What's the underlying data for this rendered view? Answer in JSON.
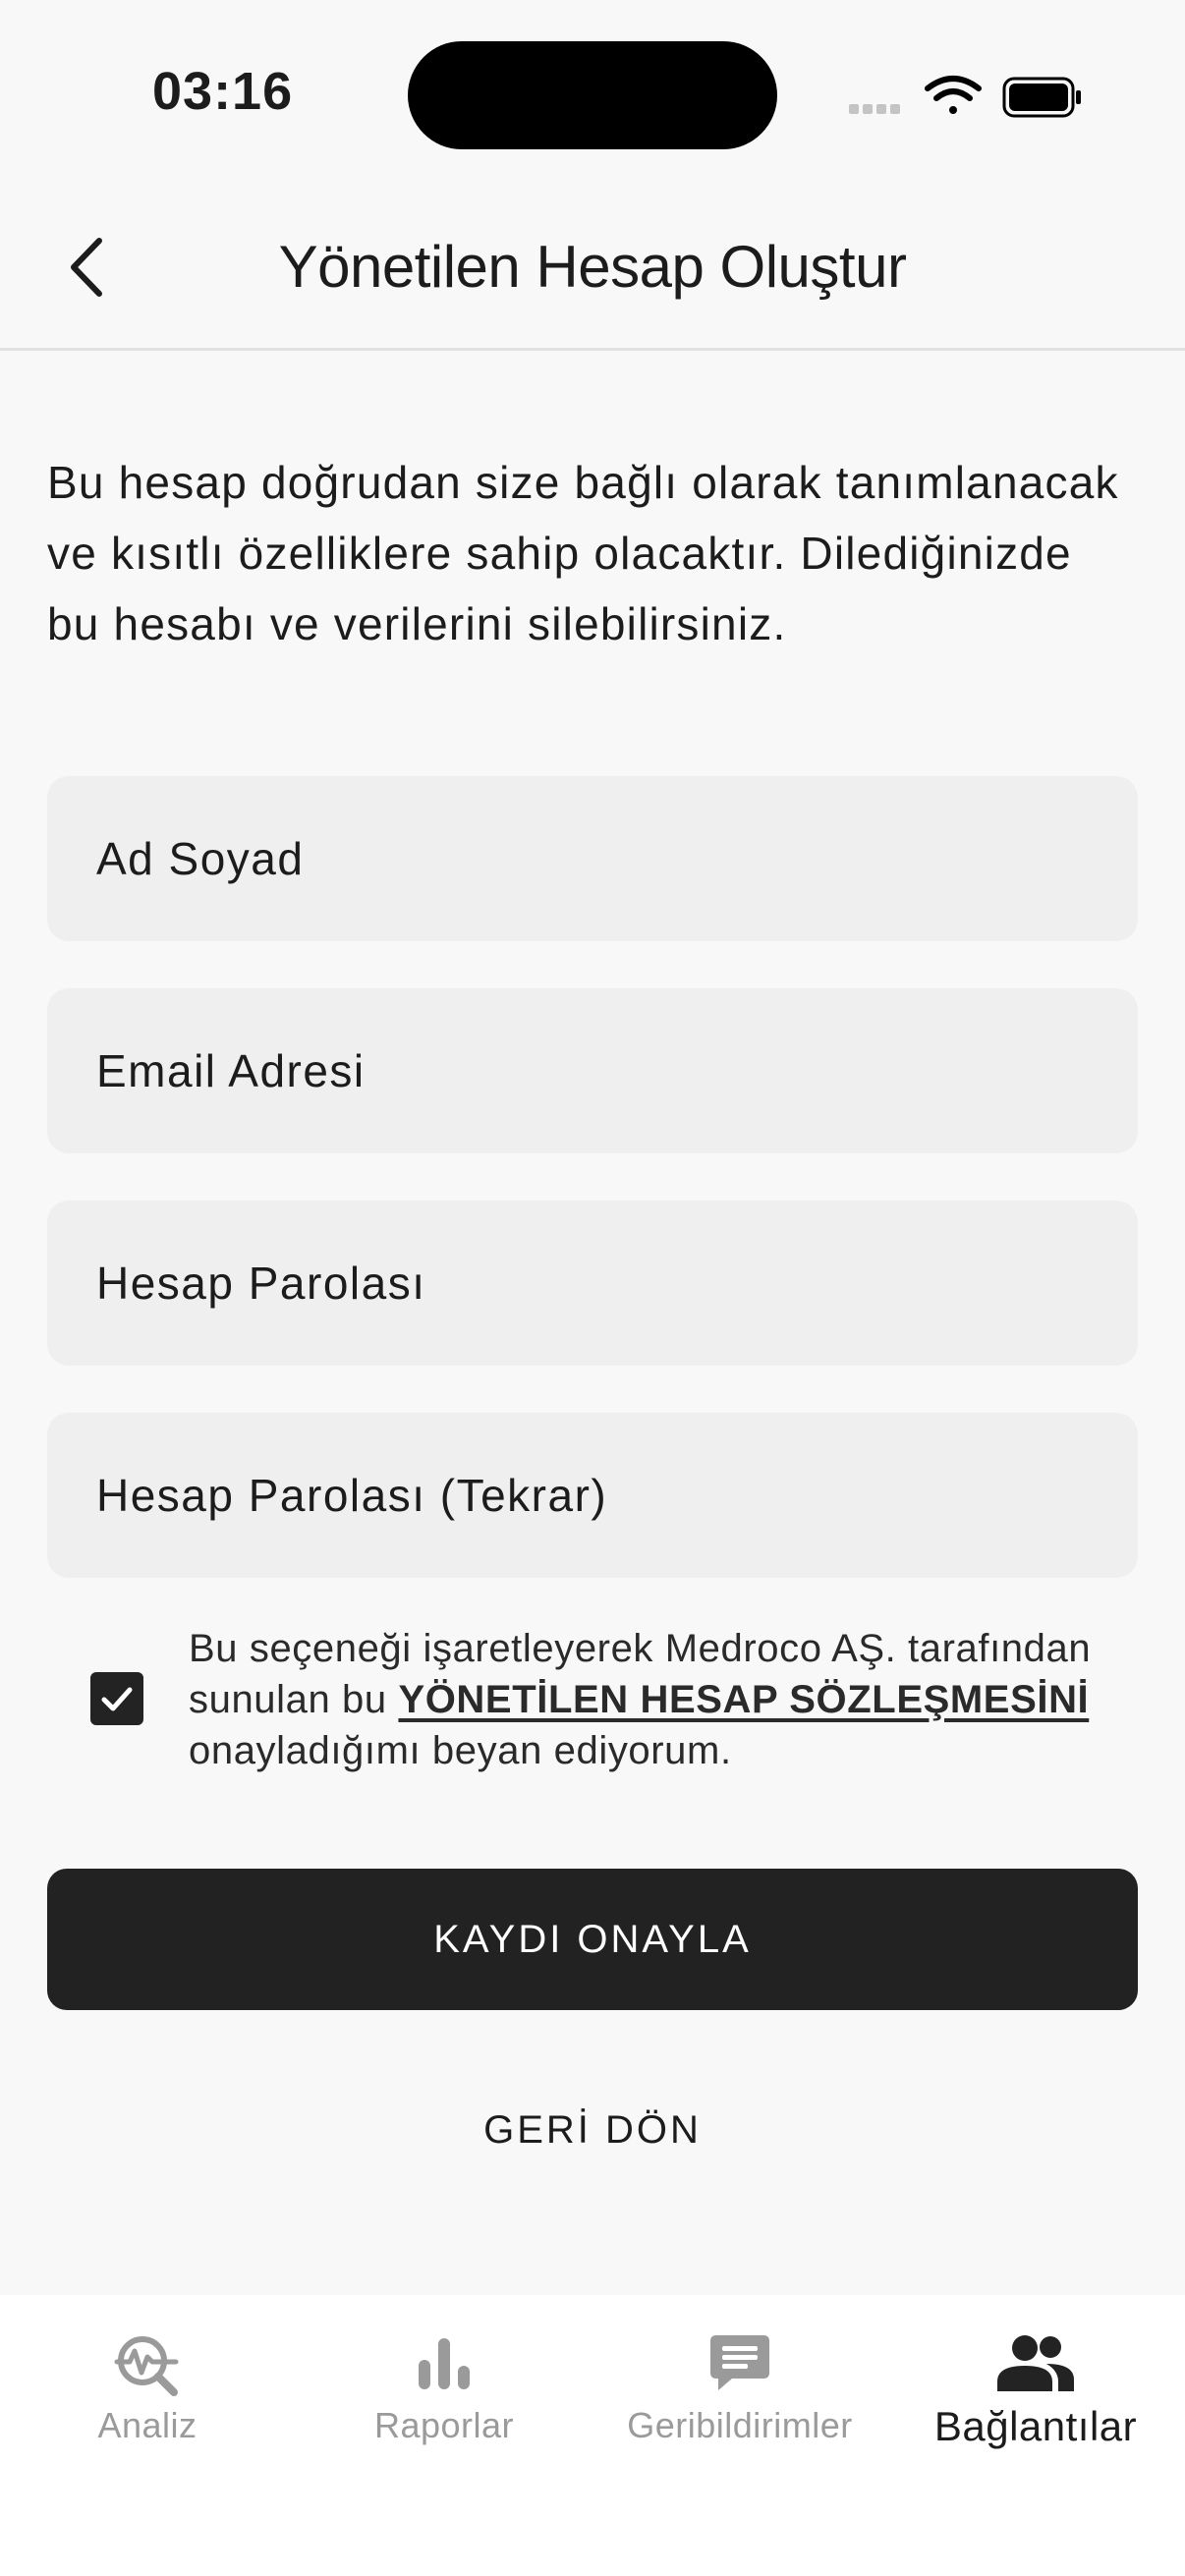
{
  "status_bar": {
    "time": "03:16"
  },
  "header": {
    "title": "Yönetilen Hesap Oluştur"
  },
  "intro": "Bu hesap doğrudan size bağlı olarak tanımlanacak ve kısıtlı özelliklere sahip olacaktır. Dilediğinizde bu hesabı ve verilerini silebilirsiniz.",
  "form": {
    "full_name_placeholder": "Ad Soyad",
    "email_placeholder": "Email Adresi",
    "password_placeholder": "Hesap Parolası",
    "password_repeat_placeholder": "Hesap Parolası (Tekrar)"
  },
  "consent": {
    "checked": true,
    "text_before": "Bu seçeneği işaretleyerek Medroco AŞ. tarafından sunulan bu ",
    "link_text": "YÖNETİLEN HESAP SÖZLEŞMESİNİ",
    "text_after": " onayladığımı beyan ediyorum."
  },
  "actions": {
    "confirm_label": "KAYDI ONAYLA",
    "back_label": "GERİ DÖN"
  },
  "tabs": [
    {
      "label": "Analiz",
      "icon": "analysis-icon",
      "active": false
    },
    {
      "label": "Raporlar",
      "icon": "bar-chart-icon",
      "active": false
    },
    {
      "label": "Geribildirimler",
      "icon": "message-icon",
      "active": false
    },
    {
      "label": "Bağlantılar",
      "icon": "people-icon",
      "active": true
    }
  ],
  "colors": {
    "background": "#f8f8f8",
    "field": "#efefef",
    "primary": "#222222",
    "inactive_tab": "#9a9a9a"
  }
}
